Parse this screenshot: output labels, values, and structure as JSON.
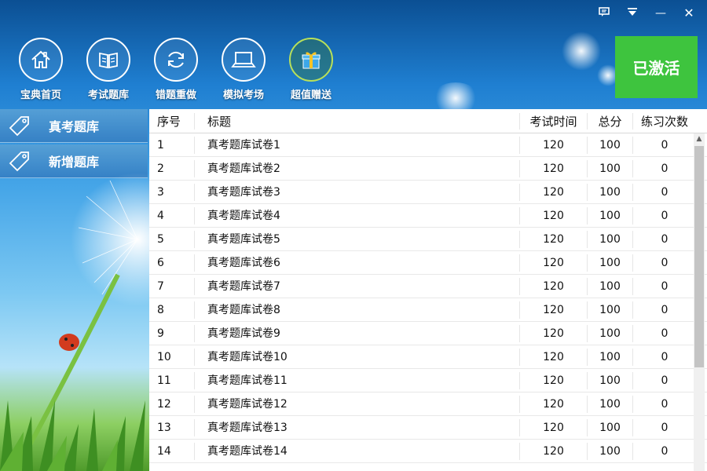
{
  "window_controls": {
    "feedback_icon": "chat-bubble-icon",
    "menu_icon": "dropdown-menu-icon",
    "minimize": "—",
    "close": "✕"
  },
  "nav": [
    {
      "label": "宝典首页",
      "icon": "home-icon"
    },
    {
      "label": "考试题库",
      "icon": "book-icon"
    },
    {
      "label": "错题重做",
      "icon": "refresh-icon"
    },
    {
      "label": "模拟考场",
      "icon": "laptop-icon"
    },
    {
      "label": "超值赠送",
      "icon": "gift-icon"
    }
  ],
  "activate_label": "已激活",
  "sidebar": {
    "items": [
      {
        "label": "真考题库",
        "icon": "tag-icon"
      },
      {
        "label": "新增题库",
        "icon": "tag-icon"
      }
    ]
  },
  "table": {
    "headers": {
      "no": "序号",
      "title": "标题",
      "time": "考试时间",
      "score": "总分",
      "count": "练习次数"
    },
    "rows": [
      {
        "no": "1",
        "title": "真考题库试卷1",
        "time": "120",
        "score": "100",
        "count": "0"
      },
      {
        "no": "2",
        "title": "真考题库试卷2",
        "time": "120",
        "score": "100",
        "count": "0"
      },
      {
        "no": "3",
        "title": "真考题库试卷3",
        "time": "120",
        "score": "100",
        "count": "0"
      },
      {
        "no": "4",
        "title": "真考题库试卷4",
        "time": "120",
        "score": "100",
        "count": "0"
      },
      {
        "no": "5",
        "title": "真考题库试卷5",
        "time": "120",
        "score": "100",
        "count": "0"
      },
      {
        "no": "6",
        "title": "真考题库试卷6",
        "time": "120",
        "score": "100",
        "count": "0"
      },
      {
        "no": "7",
        "title": "真考题库试卷7",
        "time": "120",
        "score": "100",
        "count": "0"
      },
      {
        "no": "8",
        "title": "真考题库试卷8",
        "time": "120",
        "score": "100",
        "count": "0"
      },
      {
        "no": "9",
        "title": "真考题库试卷9",
        "time": "120",
        "score": "100",
        "count": "0"
      },
      {
        "no": "10",
        "title": "真考题库试卷10",
        "time": "120",
        "score": "100",
        "count": "0"
      },
      {
        "no": "11",
        "title": "真考题库试卷11",
        "time": "120",
        "score": "100",
        "count": "0"
      },
      {
        "no": "12",
        "title": "真考题库试卷12",
        "time": "120",
        "score": "100",
        "count": "0"
      },
      {
        "no": "13",
        "title": "真考题库试卷13",
        "time": "120",
        "score": "100",
        "count": "0"
      },
      {
        "no": "14",
        "title": "真考题库试卷14",
        "time": "120",
        "score": "100",
        "count": "0"
      }
    ]
  },
  "colors": {
    "accent_green": "#3ec43e",
    "sidebar_blue": "#3580c4"
  }
}
